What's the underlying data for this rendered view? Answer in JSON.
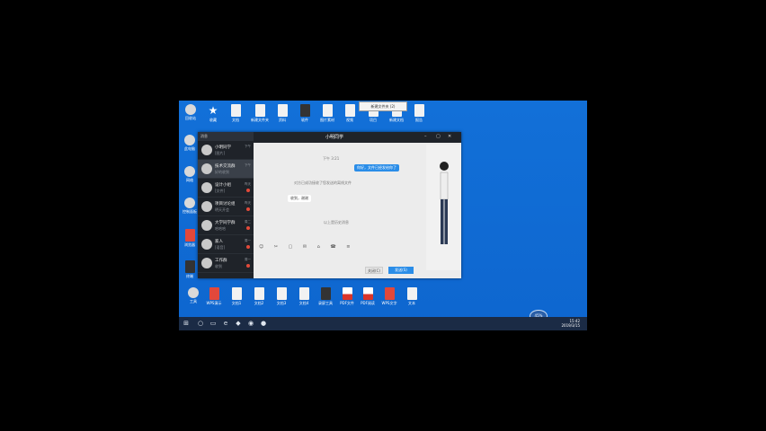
{
  "desktop": {
    "top_icons": [
      {
        "label": "回收站",
        "icon": "recycle-bin-icon",
        "kind": "app"
      },
      {
        "label": "收藏",
        "icon": "star-icon",
        "kind": "star"
      },
      {
        "label": "文档",
        "icon": "file-icon",
        "kind": "file"
      },
      {
        "label": "新建文件夹",
        "icon": "file-icon",
        "kind": "file"
      },
      {
        "label": "资料",
        "icon": "file-icon",
        "kind": "file"
      },
      {
        "label": "软件",
        "icon": "file-icon",
        "kind": "dark"
      },
      {
        "label": "图片素材",
        "icon": "file-icon",
        "kind": "file"
      },
      {
        "label": "视频",
        "icon": "file-icon",
        "kind": "file"
      },
      {
        "label": "项目",
        "icon": "file-icon",
        "kind": "file"
      },
      {
        "label": "新建文档",
        "icon": "file-icon",
        "kind": "file"
      },
      {
        "label": "报告",
        "icon": "file-icon",
        "kind": "file"
      }
    ],
    "left_icons": [
      {
        "label": "此电脑",
        "icon": "computer-icon",
        "kind": "app"
      },
      {
        "label": "网络",
        "icon": "network-icon",
        "kind": "app"
      },
      {
        "label": "控制面板",
        "icon": "control-panel-icon",
        "kind": "app"
      },
      {
        "label": "浏览器",
        "icon": "browser-icon",
        "kind": "red"
      },
      {
        "label": "终端",
        "icon": "terminal-icon",
        "kind": "dark"
      }
    ],
    "bottom_icons": [
      {
        "label": "工具",
        "icon": "tool-icon",
        "kind": "app"
      },
      {
        "label": "WPS演示",
        "icon": "presentation-icon",
        "kind": "red"
      },
      {
        "label": "文档1",
        "icon": "file-icon",
        "kind": "file"
      },
      {
        "label": "文档2",
        "icon": "file-icon",
        "kind": "file"
      },
      {
        "label": "文档3",
        "icon": "file-icon",
        "kind": "file"
      },
      {
        "label": "文档4",
        "icon": "file-icon",
        "kind": "file"
      },
      {
        "label": "录屏工具",
        "icon": "recorder-icon",
        "kind": "dark"
      },
      {
        "label": "PDF文件",
        "icon": "pdf-icon",
        "kind": "pdf"
      },
      {
        "label": "PDF阅读",
        "icon": "pdf-icon",
        "kind": "pdf"
      },
      {
        "label": "WPS文字",
        "icon": "wps-icon",
        "kind": "red"
      },
      {
        "label": "文本",
        "icon": "file-icon",
        "kind": "file"
      }
    ],
    "tooltip": "新建文件夹 (2)"
  },
  "qq": {
    "sidebar_title": "消息",
    "contacts": [
      {
        "name": "小明同学",
        "msg": "[图片]",
        "time": "下午"
      },
      {
        "name": "技术交流群",
        "msg": "好的收到",
        "time": "下午"
      },
      {
        "name": "设计小组",
        "msg": "[文件]",
        "time": "昨天"
      },
      {
        "name": "项目讨论组",
        "msg": "明天开会",
        "time": "昨天"
      },
      {
        "name": "大学同学群",
        "msg": "哈哈哈",
        "time": "周二"
      },
      {
        "name": "家人",
        "msg": "[语音]",
        "time": "周一"
      },
      {
        "name": "工作群",
        "msg": "收到",
        "time": "周一"
      }
    ],
    "chat_title": "小明同学",
    "messages": {
      "time1": "下午 3:21",
      "out1": "你好，文件已经发给你了",
      "sys1": "对方已成功接收了您发送的离线文件",
      "in1": "收到，谢谢",
      "sys2": "以上是历史消息"
    },
    "toolbar_icons": "☺ ✂ ▢ ✉ ⌂ ☎ ≡",
    "close_label": "关闭(C)",
    "send_label": "发送(S)"
  },
  "taskbar": {
    "start": "⊞",
    "items": [
      "○",
      "▭",
      "e",
      "◆",
      "◉",
      "●"
    ],
    "time": "15:42",
    "date": "2019/3/15",
    "badge": "45%"
  }
}
